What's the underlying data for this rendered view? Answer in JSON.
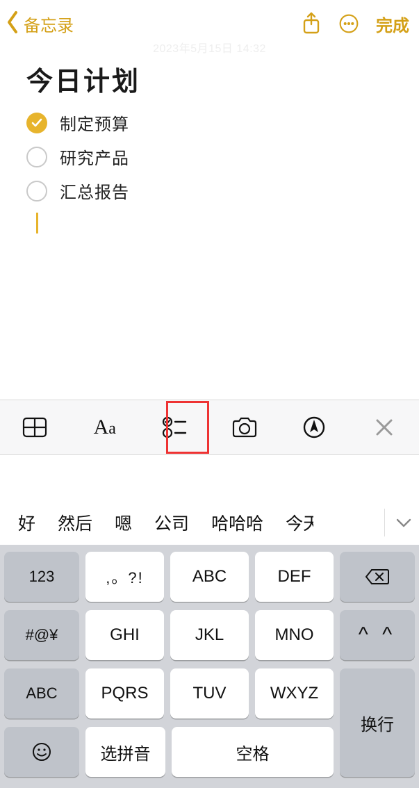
{
  "header": {
    "back_label": "备忘录",
    "done_label": "完成"
  },
  "timestamp": "2023年5月15日 14:32",
  "note": {
    "title": "今日计划",
    "items": [
      {
        "text": "制定预算",
        "checked": true
      },
      {
        "text": "研究产品",
        "checked": false
      },
      {
        "text": "汇总报告",
        "checked": false
      }
    ]
  },
  "toolbar": {
    "aa": "Aa"
  },
  "suggestions": [
    "好",
    "然后",
    "嗯",
    "公司",
    "哈哈哈",
    "今天"
  ],
  "keyboard": {
    "row1": [
      "123",
      ",。?!",
      "ABC",
      "DEF"
    ],
    "row2": [
      "#@¥",
      "GHI",
      "JKL",
      "MNO"
    ],
    "row3": [
      "ABC",
      "PQRS",
      "TUV",
      "WXYZ"
    ],
    "row4": {
      "pinyin": "选拼音",
      "space": "空格"
    },
    "side": {
      "faces": "^ ^",
      "return": "换行"
    }
  }
}
